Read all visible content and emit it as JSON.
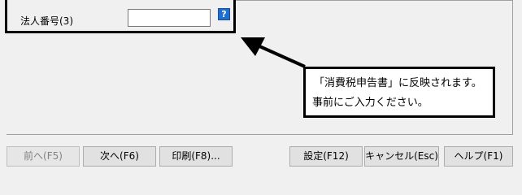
{
  "form": {
    "field_label": "法人番号(3)",
    "field_value": "",
    "help_icon_glyph": "?"
  },
  "callout": {
    "line1": "「消費税申告書」に反映されます。",
    "line2": "事前にご入力ください。"
  },
  "buttons": {
    "prev": "前へ(F5)",
    "next": "次へ(F6)",
    "print": "印刷(F8)...",
    "settings": "設定(F12)",
    "cancel": "キャンセル(Esc)",
    "help": "ヘルプ(F1)"
  },
  "colors": {
    "help_icon": "#1f6fd1",
    "background": "#f0f0f0"
  }
}
